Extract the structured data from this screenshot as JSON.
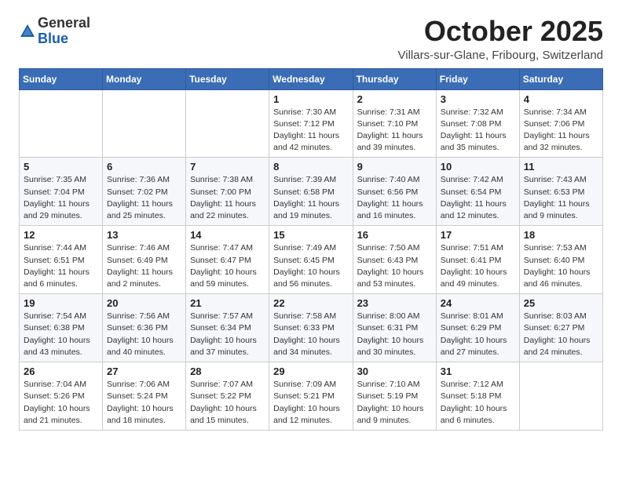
{
  "header": {
    "logo_general": "General",
    "logo_blue": "Blue",
    "month": "October 2025",
    "location": "Villars-sur-Glane, Fribourg, Switzerland"
  },
  "weekdays": [
    "Sunday",
    "Monday",
    "Tuesday",
    "Wednesday",
    "Thursday",
    "Friday",
    "Saturday"
  ],
  "weeks": [
    [
      {
        "day": "",
        "info": ""
      },
      {
        "day": "",
        "info": ""
      },
      {
        "day": "",
        "info": ""
      },
      {
        "day": "1",
        "info": "Sunrise: 7:30 AM\nSunset: 7:12 PM\nDaylight: 11 hours\nand 42 minutes."
      },
      {
        "day": "2",
        "info": "Sunrise: 7:31 AM\nSunset: 7:10 PM\nDaylight: 11 hours\nand 39 minutes."
      },
      {
        "day": "3",
        "info": "Sunrise: 7:32 AM\nSunset: 7:08 PM\nDaylight: 11 hours\nand 35 minutes."
      },
      {
        "day": "4",
        "info": "Sunrise: 7:34 AM\nSunset: 7:06 PM\nDaylight: 11 hours\nand 32 minutes."
      }
    ],
    [
      {
        "day": "5",
        "info": "Sunrise: 7:35 AM\nSunset: 7:04 PM\nDaylight: 11 hours\nand 29 minutes."
      },
      {
        "day": "6",
        "info": "Sunrise: 7:36 AM\nSunset: 7:02 PM\nDaylight: 11 hours\nand 25 minutes."
      },
      {
        "day": "7",
        "info": "Sunrise: 7:38 AM\nSunset: 7:00 PM\nDaylight: 11 hours\nand 22 minutes."
      },
      {
        "day": "8",
        "info": "Sunrise: 7:39 AM\nSunset: 6:58 PM\nDaylight: 11 hours\nand 19 minutes."
      },
      {
        "day": "9",
        "info": "Sunrise: 7:40 AM\nSunset: 6:56 PM\nDaylight: 11 hours\nand 16 minutes."
      },
      {
        "day": "10",
        "info": "Sunrise: 7:42 AM\nSunset: 6:54 PM\nDaylight: 11 hours\nand 12 minutes."
      },
      {
        "day": "11",
        "info": "Sunrise: 7:43 AM\nSunset: 6:53 PM\nDaylight: 11 hours\nand 9 minutes."
      }
    ],
    [
      {
        "day": "12",
        "info": "Sunrise: 7:44 AM\nSunset: 6:51 PM\nDaylight: 11 hours\nand 6 minutes."
      },
      {
        "day": "13",
        "info": "Sunrise: 7:46 AM\nSunset: 6:49 PM\nDaylight: 11 hours\nand 2 minutes."
      },
      {
        "day": "14",
        "info": "Sunrise: 7:47 AM\nSunset: 6:47 PM\nDaylight: 10 hours\nand 59 minutes."
      },
      {
        "day": "15",
        "info": "Sunrise: 7:49 AM\nSunset: 6:45 PM\nDaylight: 10 hours\nand 56 minutes."
      },
      {
        "day": "16",
        "info": "Sunrise: 7:50 AM\nSunset: 6:43 PM\nDaylight: 10 hours\nand 53 minutes."
      },
      {
        "day": "17",
        "info": "Sunrise: 7:51 AM\nSunset: 6:41 PM\nDaylight: 10 hours\nand 49 minutes."
      },
      {
        "day": "18",
        "info": "Sunrise: 7:53 AM\nSunset: 6:40 PM\nDaylight: 10 hours\nand 46 minutes."
      }
    ],
    [
      {
        "day": "19",
        "info": "Sunrise: 7:54 AM\nSunset: 6:38 PM\nDaylight: 10 hours\nand 43 minutes."
      },
      {
        "day": "20",
        "info": "Sunrise: 7:56 AM\nSunset: 6:36 PM\nDaylight: 10 hours\nand 40 minutes."
      },
      {
        "day": "21",
        "info": "Sunrise: 7:57 AM\nSunset: 6:34 PM\nDaylight: 10 hours\nand 37 minutes."
      },
      {
        "day": "22",
        "info": "Sunrise: 7:58 AM\nSunset: 6:33 PM\nDaylight: 10 hours\nand 34 minutes."
      },
      {
        "day": "23",
        "info": "Sunrise: 8:00 AM\nSunset: 6:31 PM\nDaylight: 10 hours\nand 30 minutes."
      },
      {
        "day": "24",
        "info": "Sunrise: 8:01 AM\nSunset: 6:29 PM\nDaylight: 10 hours\nand 27 minutes."
      },
      {
        "day": "25",
        "info": "Sunrise: 8:03 AM\nSunset: 6:27 PM\nDaylight: 10 hours\nand 24 minutes."
      }
    ],
    [
      {
        "day": "26",
        "info": "Sunrise: 7:04 AM\nSunset: 5:26 PM\nDaylight: 10 hours\nand 21 minutes."
      },
      {
        "day": "27",
        "info": "Sunrise: 7:06 AM\nSunset: 5:24 PM\nDaylight: 10 hours\nand 18 minutes."
      },
      {
        "day": "28",
        "info": "Sunrise: 7:07 AM\nSunset: 5:22 PM\nDaylight: 10 hours\nand 15 minutes."
      },
      {
        "day": "29",
        "info": "Sunrise: 7:09 AM\nSunset: 5:21 PM\nDaylight: 10 hours\nand 12 minutes."
      },
      {
        "day": "30",
        "info": "Sunrise: 7:10 AM\nSunset: 5:19 PM\nDaylight: 10 hours\nand 9 minutes."
      },
      {
        "day": "31",
        "info": "Sunrise: 7:12 AM\nSunset: 5:18 PM\nDaylight: 10 hours\nand 6 minutes."
      },
      {
        "day": "",
        "info": ""
      }
    ]
  ]
}
